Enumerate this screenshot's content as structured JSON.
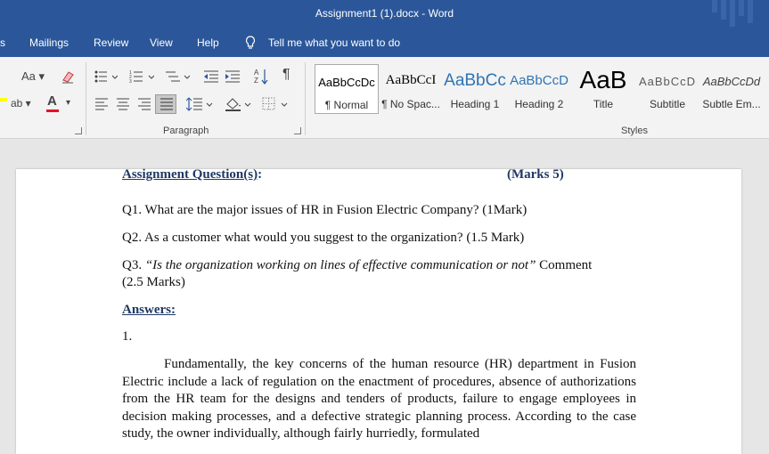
{
  "window": {
    "title": "Assignment1 (1).docx  -  Word"
  },
  "tabs": [
    {
      "label": "s"
    },
    {
      "label": "Mailings"
    },
    {
      "label": "Review"
    },
    {
      "label": "View"
    },
    {
      "label": "Help"
    }
  ],
  "tell_me": {
    "label": "Tell me what you want to do"
  },
  "ribbon": {
    "font_size_label": "Aa",
    "paragraph_group": "Paragraph",
    "styles_group": "Styles",
    "styles": [
      {
        "preview": "AaBbCcDc",
        "name": "¶ Normal"
      },
      {
        "preview": "AaBbCcI",
        "name": "¶ No Spac..."
      },
      {
        "preview": "AaBbCc",
        "name": "Heading 1"
      },
      {
        "preview": "AaBbCcD",
        "name": "Heading 2"
      },
      {
        "preview": "AaB",
        "name": "Title"
      },
      {
        "preview": "AaBbCcD",
        "name": "Subtitle"
      },
      {
        "preview": "AaBbCcDd",
        "name": "Subtle Em..."
      }
    ]
  },
  "document": {
    "heading": "Assignment Question(s)",
    "heading_colon": ":",
    "marks": "(Marks 5)",
    "q1": "Q1.  What are the major issues of HR in Fusion Electric Company? (1Mark)",
    "q2": "Q2. As a customer what would you suggest to the organization? (1.5 Mark)",
    "q3_prefix": "Q3.  ",
    "q3_quote": "“Is the organization working on lines of effective communication or not”",
    "q3_suffix": " Comment",
    "q3_line2": "(2.5 Marks)",
    "answers_label": "Answers:",
    "answer_number": "1.",
    "answer_paragraph": "Fundamentally, the key concerns of the human resource (HR) department in Fusion Electric include a lack of regulation on the enactment of procedures, absence of authorizations from the HR team for the designs and tenders of products, failure to engage employees in decision making processes, and a defective strategic planning process. According to the case study, the owner individually, although fairly hurriedly, formulated"
  },
  "colors": {
    "title_bar": "#2b579a",
    "heading_navy": "#1f3864",
    "heading1_blue": "#2e74b5"
  }
}
